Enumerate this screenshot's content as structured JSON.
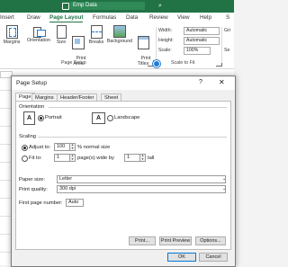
{
  "title_bar": {
    "document_name": "Emp Data",
    "search_glyph": "⌕"
  },
  "tabs": [
    "Insert",
    "Draw",
    "Page Layout",
    "Formulas",
    "Data",
    "Review",
    "View",
    "Help",
    "S"
  ],
  "active_tab": "Page Layout",
  "ribbon": {
    "buttons": [
      {
        "label": "Margins"
      },
      {
        "label": "Orientation"
      },
      {
        "label": "Size"
      },
      {
        "label": "Print\nArea"
      },
      {
        "label": "Breaks"
      },
      {
        "label": "Background"
      },
      {
        "label": "Print\nTitles"
      }
    ],
    "page_setup_group": "Page Setup",
    "scale_group": "Scale to Fit",
    "width_label": "Width:",
    "width_value": "Automatic",
    "height_label": "Height:",
    "height_value": "Automatic",
    "scale_label": "Scale:",
    "scale_value": "100%",
    "right_cut": "Gri",
    "right_cut2": "Se"
  },
  "dialog": {
    "title": "Page Setup",
    "help": "?",
    "close": "✕",
    "tabs": [
      "Page",
      "Margins",
      "Header/Footer",
      "Sheet"
    ],
    "active_tab": "Page",
    "orientation": {
      "heading": "Orientation",
      "portrait": "Portrait",
      "landscape": "Landscape",
      "selected": "Portrait",
      "glyph": "A"
    },
    "scaling": {
      "heading": "Scaling",
      "adjust_to": "Adjust to:",
      "adjust_value": "100",
      "adjust_suffix": "% normal size",
      "fit_to": "Fit to:",
      "fit_wide": "1",
      "fit_wide_suffix": "page(s) wide by",
      "fit_tall": "1",
      "fit_tall_suffix": "tall",
      "selected": "Adjust to"
    },
    "paper_size_label": "Paper size:",
    "paper_size_value": "Letter",
    "print_quality_label": "Print quality:",
    "print_quality_value": "300 dpi",
    "first_page_label": "First page number:",
    "first_page_value": "Auto",
    "print_button": "Print...",
    "print_preview_button": "Print Preview",
    "options_button": "Options...",
    "ok_button": "OK",
    "cancel_button": "Cancel"
  },
  "colors": {
    "excel_green": "#217346",
    "accent_blue": "#1e7bd7"
  }
}
